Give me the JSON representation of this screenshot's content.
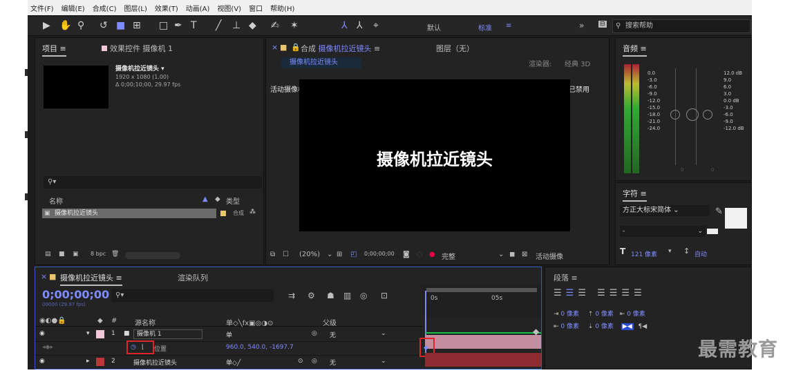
{
  "menu": [
    "文件(F)",
    "编辑(E)",
    "合成(C)",
    "图层(L)",
    "效果(T)",
    "动画(A)",
    "视图(V)",
    "窗口",
    "帮助(H)"
  ],
  "toolbar": {
    "workspace_default": "默认",
    "workspace_standard": "标准",
    "search_placeholder": "搜索帮助"
  },
  "project": {
    "tab_project": "项目",
    "tab_effects": "效果控件 摄像机 1",
    "comp_name": "摄像机拉近镜头",
    "comp_res": "1920 x 1080 (1.00)",
    "comp_dur": "Δ 0;00;10;00, 29.97 fps",
    "col_name": "名称",
    "col_type": "类型",
    "item_name": "摄像机拉近镜头",
    "item_type": "合成",
    "bpc": "8 bpc"
  },
  "comp": {
    "tab": "合成",
    "tab_name": "摄像机拉近镜头",
    "layer_tab": "图层（无）",
    "sub_tab": "摄像机拉近镜头",
    "renderer_label": "渲染器:",
    "renderer": "经典 3D",
    "active_camera": "活动摄像机",
    "accel": "显示加速已禁用",
    "viewer_text": "摄像机拉近镜头",
    "zoom": "(20%)",
    "timecode": "0;00;00;00",
    "quality": "完整",
    "view": "活动摄像"
  },
  "audio": {
    "title": "音频",
    "left_db": [
      "0.0",
      "-3.0",
      "-6.0",
      "-9.0",
      "-12.0",
      "-15.0",
      "-18.0",
      "-21.0",
      "-24.0"
    ],
    "right_db": [
      "12.0 dB",
      "9.0",
      "6.0",
      "3.0",
      "0.0 dB",
      "-3.0",
      "-6.0",
      "-9.0",
      "-12.0 dB"
    ],
    "zero": "0"
  },
  "character": {
    "title": "字符",
    "font": "方正大标宋简体",
    "size": "121 像素",
    "leading": "自动"
  },
  "timeline": {
    "tab": "摄像机拉近镜头",
    "render_queue": "渲染队列",
    "time": "0;00;00;00",
    "fps": "00000 (29.97 fps)",
    "ruler_start": "0s",
    "ruler_mid": "05s",
    "col_source": "源名称",
    "col_parent": "父级",
    "layer1_num": "1",
    "layer1_name": "摄像机 1",
    "layer1_parent": "无",
    "prop_name": "位置",
    "prop_value": "960.0, 540.0, -1697.7",
    "layer2_num": "2",
    "layer2_name": "摄像机拉近镜头",
    "layer2_parent": "无"
  },
  "paragraph": {
    "title": "段落",
    "v1": "0 像素",
    "v2": "0 像素",
    "v3": "0 像素",
    "v4": "0 像素",
    "v5": "0 像素"
  },
  "watermark": "最需教育",
  "colors": {
    "accent_blue": "#7f8cff",
    "highlight_red": "#e0242c",
    "layer_pink": "#f1c7d9",
    "layer_red": "#c0353a"
  }
}
